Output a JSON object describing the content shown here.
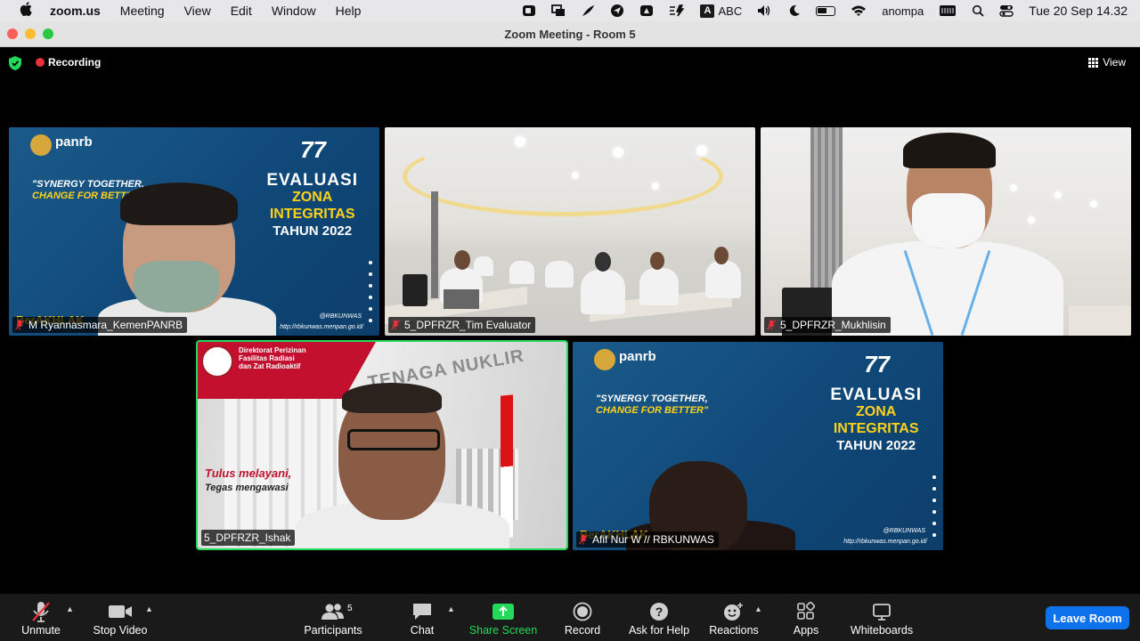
{
  "menubar": {
    "app": "zoom.us",
    "items": [
      "Meeting",
      "View",
      "Edit",
      "Window",
      "Help"
    ],
    "input_source": "ABC",
    "user": "anompa",
    "clock": "Tue 20 Sep  14.32"
  },
  "window": {
    "title": "Zoom Meeting - Room 5"
  },
  "meeting": {
    "recording_label": "Recording",
    "view_label": "View"
  },
  "tiles": [
    {
      "name": "M Ryannasmara_KemenPANRB",
      "slide": {
        "brand": "panrb",
        "anniv": "77",
        "synergy1": "\"SYNERGY TOGETHER,",
        "synergy2": "CHANGE FOR BETTER\"",
        "eval1": "EVALUASI",
        "eval2": "ZONA",
        "eval3": "INTEGRITAS",
        "eval4": "TAHUN 2022",
        "berakhlak": "BerAKHLAK",
        "handle": "@RBKUNWAS",
        "url": "http://rbkunwas.menpan.go.id/"
      }
    },
    {
      "name": "5_DPFRZR_Tim Evaluator"
    },
    {
      "name": "5_DPFRZR_Mukhlisin"
    },
    {
      "name": "5_DPFRZR_Ishak",
      "banner1": "Direktorat Perizinan",
      "banner2": "Fasilitas Radiasi",
      "banner3": "dan Zat Radioaktif",
      "sign": "TENAGA NUKLIR",
      "motto1": "Tulus melayani,",
      "motto2": "Tegas mengawasi"
    },
    {
      "name": "Afif Nur W // RBKUNWAS",
      "slide": {
        "brand": "panrb",
        "anniv": "77",
        "synergy1": "\"SYNERGY TOGETHER,",
        "synergy2": "CHANGE FOR BETTER\"",
        "eval1": "EVALUASI",
        "eval2": "ZONA",
        "eval3": "INTEGRITAS",
        "eval4": "TAHUN 2022",
        "berakhlak": "BerAKHLAK",
        "handle": "@RBKUNWAS",
        "url": "http://rbkunwas.menpan.go.id/"
      }
    }
  ],
  "toolbar": {
    "unmute": "Unmute",
    "stop_video": "Stop Video",
    "participants": "Participants",
    "participants_count": "5",
    "chat": "Chat",
    "share_screen": "Share Screen",
    "record": "Record",
    "ask_for_help": "Ask for Help",
    "reactions": "Reactions",
    "apps": "Apps",
    "whiteboards": "Whiteboards",
    "leave": "Leave Room"
  },
  "colors": {
    "active_speaker": "#23d959",
    "leave_button": "#0e72ed",
    "recording_dot": "#e8313a"
  }
}
